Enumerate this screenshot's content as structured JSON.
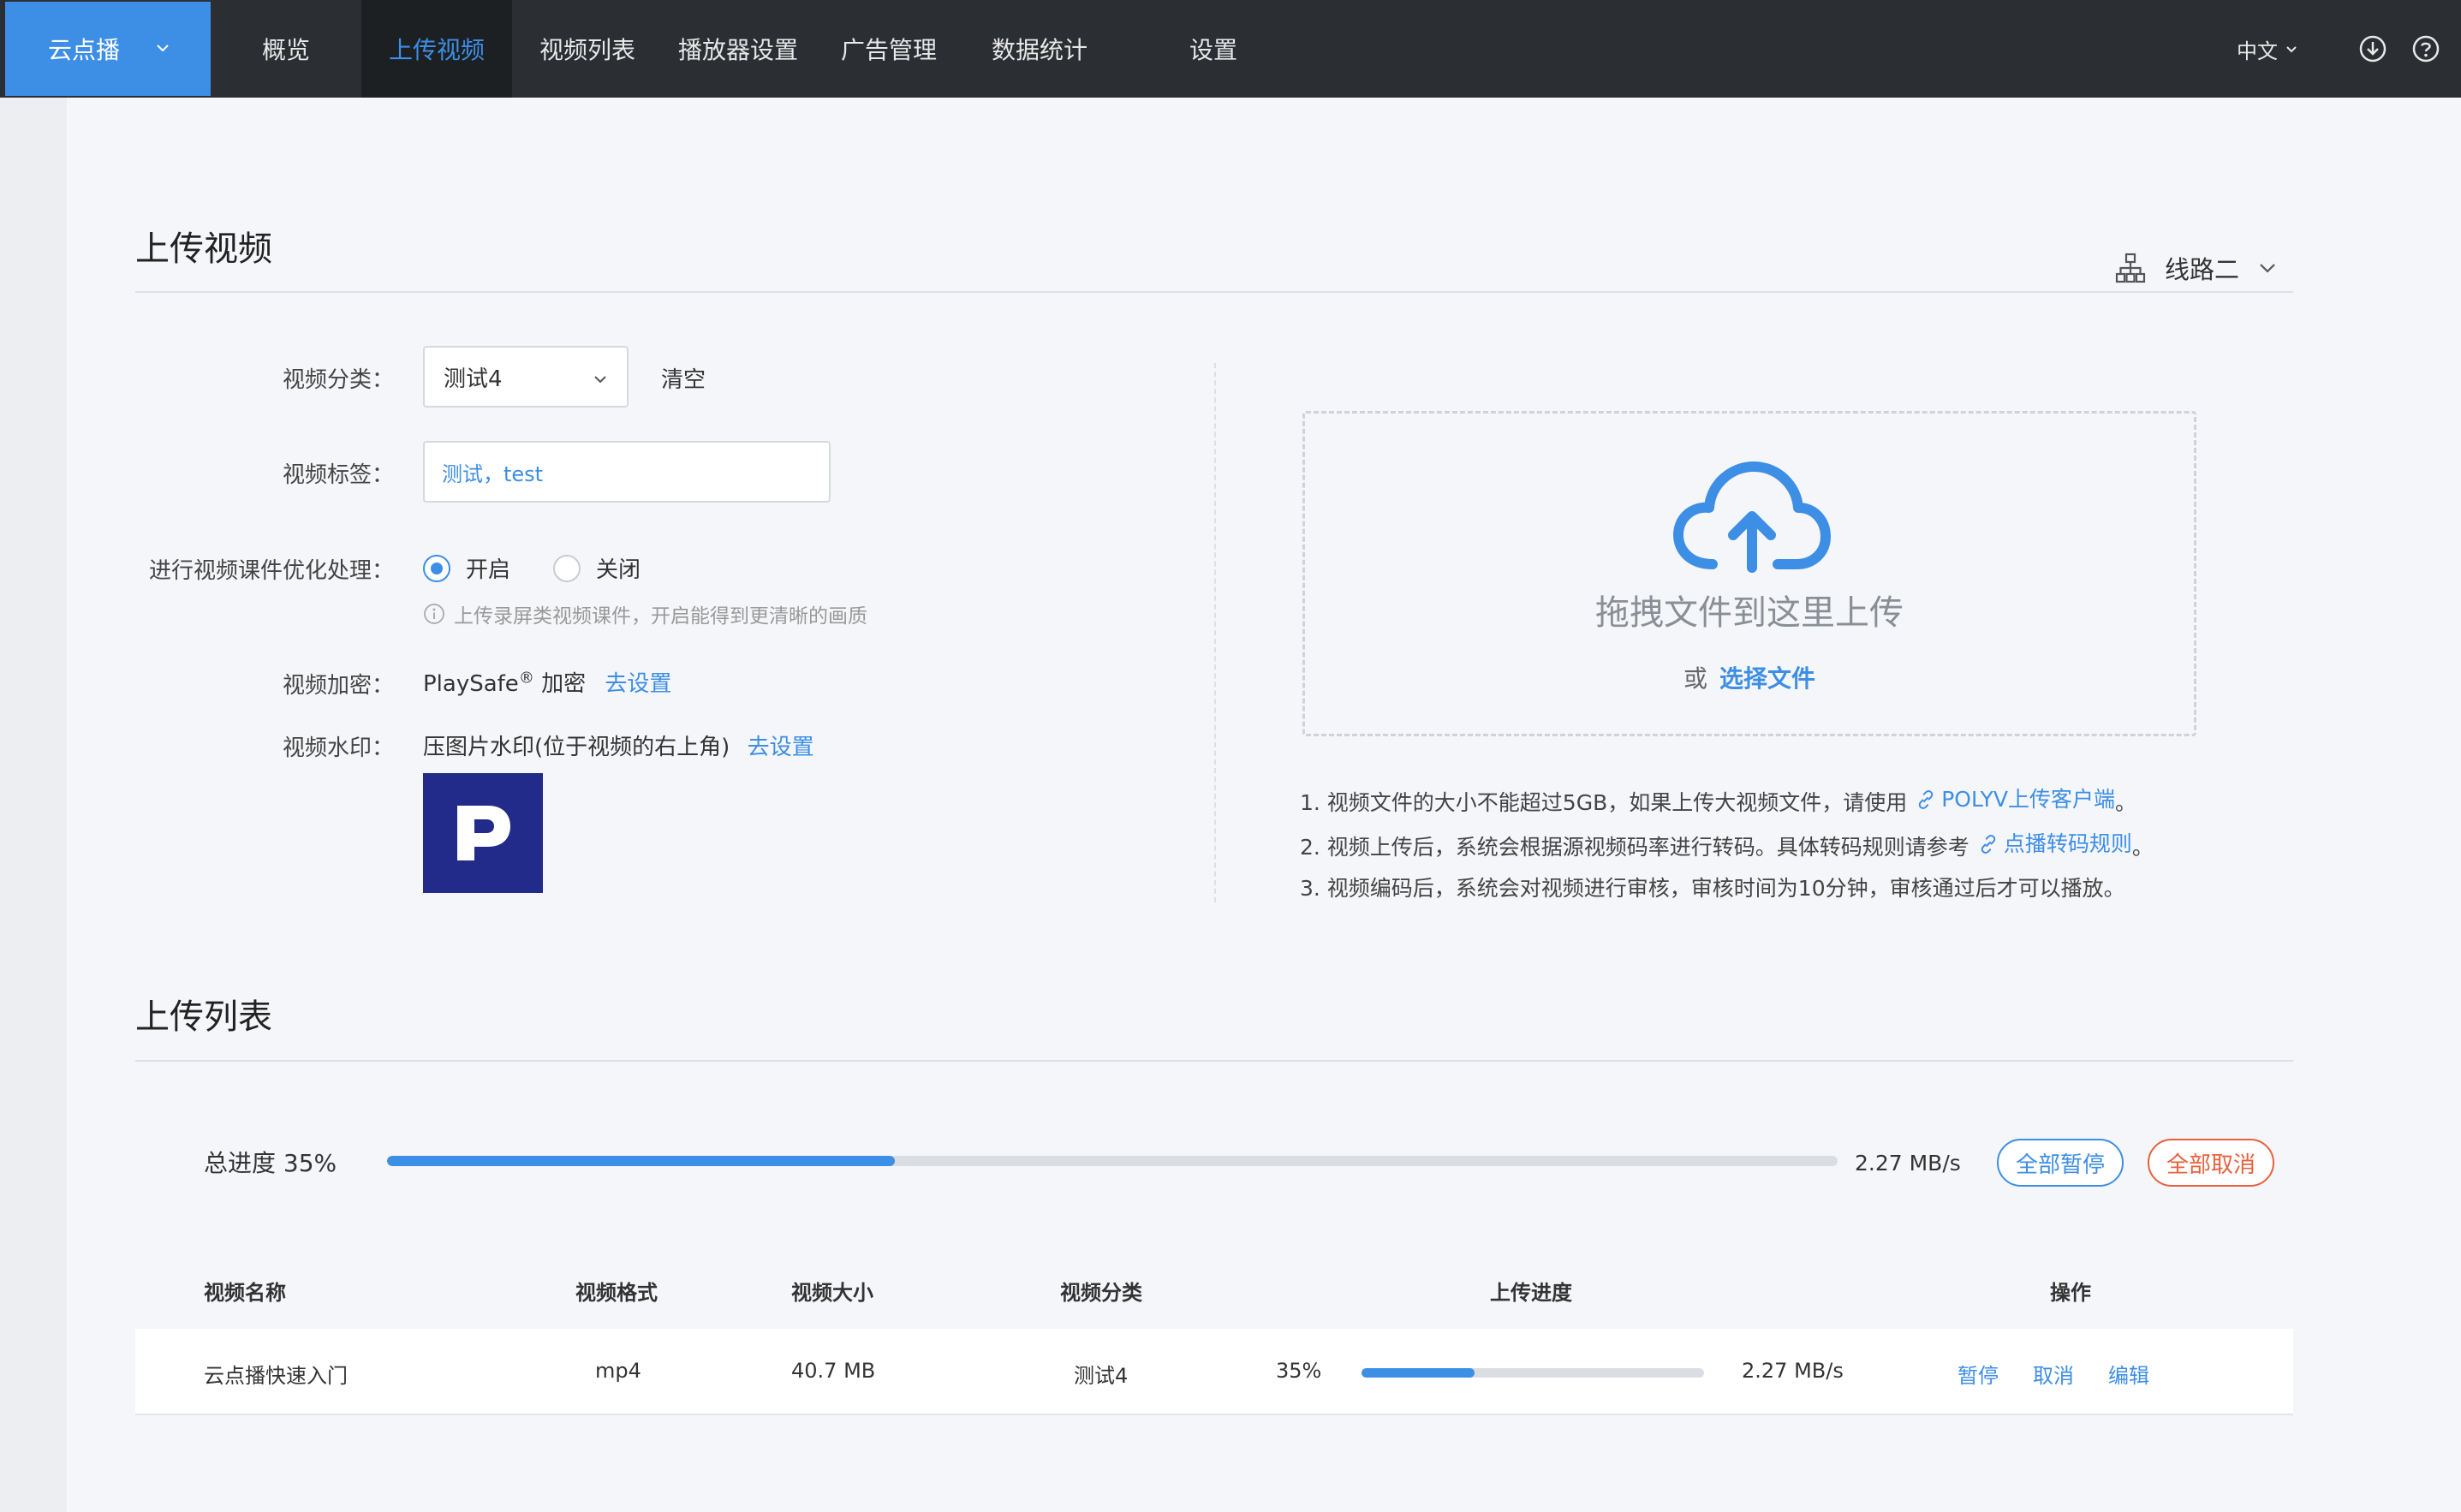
{
  "header": {
    "brand": "云点播",
    "nav": [
      {
        "label": "概览",
        "active": false
      },
      {
        "label": "上传视频",
        "active": true
      },
      {
        "label": "视频列表",
        "active": false
      },
      {
        "label": "播放器设置",
        "active": false
      },
      {
        "label": "广告管理",
        "active": false
      },
      {
        "label": "数据统计",
        "active": false
      },
      {
        "label": "设置",
        "active": false
      }
    ],
    "language": "中文",
    "icons": [
      "download-icon",
      "help-icon"
    ]
  },
  "upload": {
    "title": "上传视频",
    "route": "线路二",
    "category_label": "视频分类：",
    "category_value": "测试4",
    "clear_label": "清空",
    "tag_label": "视频标签：",
    "tag_value": "测试，test",
    "optimize_label": "进行视频课件优化处理：",
    "optimize_on": "开启",
    "optimize_off": "关闭",
    "optimize_selected": "on",
    "optimize_hint": "上传录屏类视频课件，开启能得到更清晰的画质",
    "encrypt_label": "视频加密：",
    "encrypt_name": "PlaySafe",
    "encrypt_mark": "®",
    "encrypt_suffix": "加密",
    "encrypt_link": "去设置",
    "watermark_label": "视频水印：",
    "watermark_text": "压图片水印(位于视频的右上角)",
    "watermark_link": "去设置",
    "drop_text": "拖拽文件到这里上传",
    "or_text": "或",
    "choose_file": "选择文件",
    "notes": {
      "n1_text": "1. 视频文件的大小不能超过5GB，如果上传大视频文件，请使用",
      "n1_link": "POLYV上传客户端",
      "n1_end": "。",
      "n2_text": "2. 视频上传后，系统会根据源视频码率进行转码。具体转码规则请参考",
      "n2_link": "点播转码规则",
      "n2_end": "。",
      "n3_text": "3. 视频编码后，系统会对视频进行审核，审核时间为10分钟，审核通过后才可以播放。"
    }
  },
  "upload_list": {
    "title": "上传列表",
    "total_label": "总进度 35%",
    "total_progress": 0.35,
    "total_speed": "2.27 MB/s",
    "pause_all": "全部暂停",
    "cancel_all": "全部取消",
    "columns": {
      "name": "视频名称",
      "format": "视频格式",
      "size": "视频大小",
      "category": "视频分类",
      "progress": "上传进度",
      "actions": "操作"
    },
    "rows": [
      {
        "name": "云点播快速入门",
        "format": "mp4",
        "size": "40.7 MB",
        "category": "测试4",
        "percent": "35%",
        "progress": 0.33,
        "speed": "2.27 MB/s",
        "pause": "暂停",
        "cancel": "取消",
        "edit": "编辑"
      }
    ]
  },
  "colors": {
    "accent": "#3d8ee5",
    "danger": "#e8603c",
    "topbar": "#2b2f33"
  }
}
